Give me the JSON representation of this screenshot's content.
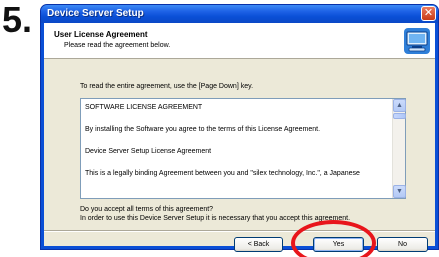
{
  "step": {
    "number": "5."
  },
  "window": {
    "title": "Device Server Setup",
    "close_glyph": "✕"
  },
  "header": {
    "title": "User License Agreement",
    "subtitle": "Please read the agreement below.",
    "icon": "computer-setup-icon"
  },
  "body": {
    "instruction": "To read the entire agreement, use the [Page Down] key.",
    "license_lines": [
      "SOFTWARE LICENSE AGREEMENT",
      "By installing the Software you agree to the terms of this License Agreement.",
      "Device Server Setup License Agreement",
      "This is a legally binding Agreement between you and \"silex technology, Inc.\", a Japanese"
    ],
    "question": "Do you accept all terms of this agreement?",
    "note": "In order to use this Device Server Setup it is necessary that you accept this agreement."
  },
  "buttons": {
    "back": "< Back",
    "yes": "Yes",
    "no": "No"
  },
  "colors": {
    "titlebar": "#0a4fd6",
    "dialog_face": "#ece9d8",
    "highlight": "#e8151b"
  }
}
